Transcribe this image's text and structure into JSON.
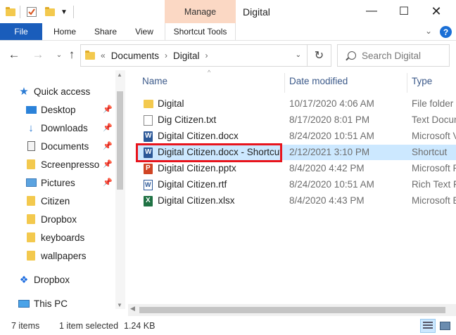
{
  "window": {
    "title": "Digital",
    "manage_label": "Manage",
    "minimize_glyph": "—",
    "maximize_glyph": "☐",
    "close_glyph": "✕"
  },
  "ribbon": {
    "tabs": [
      "File",
      "Home",
      "Share",
      "View",
      "Shortcut Tools"
    ],
    "collapse_glyph": "⌄",
    "help_glyph": "?"
  },
  "nav": {
    "back_glyph": "←",
    "forward_glyph": "→",
    "recent_glyph": "⌄",
    "up_glyph": "↑",
    "overflow_glyph": "«",
    "breadcrumb": [
      "Documents",
      "Digital"
    ],
    "separator": "›",
    "dropdown_glyph": "⌄",
    "refresh_glyph": "↻",
    "search_placeholder": "Search Digital"
  },
  "sidebar": {
    "pin_glyph": "📌",
    "items": [
      {
        "label": "Quick access",
        "icon": "star-icon",
        "pinned": false
      },
      {
        "label": "Desktop",
        "icon": "desktop-icon",
        "pinned": true
      },
      {
        "label": "Downloads",
        "icon": "download-icon",
        "pinned": true
      },
      {
        "label": "Documents",
        "icon": "documents-icon",
        "pinned": true
      },
      {
        "label": "Screenpresso",
        "icon": "folder-icon",
        "pinned": true
      },
      {
        "label": "Pictures",
        "icon": "pictures-icon",
        "pinned": true
      },
      {
        "label": "Citizen",
        "icon": "folder-icon",
        "pinned": false
      },
      {
        "label": "Dropbox",
        "icon": "dropbox-icon",
        "pinned": false
      },
      {
        "label": "keyboards",
        "icon": "folder-icon",
        "pinned": false
      },
      {
        "label": "wallpapers",
        "icon": "folder-icon",
        "pinned": false
      },
      {
        "label": "Dropbox",
        "icon": "dropbox-icon",
        "pinned": false
      },
      {
        "label": "This PC",
        "icon": "computer-icon",
        "pinned": false
      }
    ]
  },
  "filelist": {
    "columns": [
      "Name",
      "Date modified",
      "Type"
    ],
    "sort_glyph": "^",
    "rows": [
      {
        "name": "Digital",
        "date": "10/17/2020 4:06 AM",
        "type": "File folder",
        "icon": "folder-icon"
      },
      {
        "name": "Dig Citizen.txt",
        "date": "8/17/2020 8:01 PM",
        "type": "Text Docun",
        "icon": "text-file-icon"
      },
      {
        "name": "Digital Citizen.docx",
        "date": "8/24/2020 10:51 AM",
        "type": "Microsoft V",
        "icon": "word-file-icon"
      },
      {
        "name": "Digital Citizen.docx - Shortcut",
        "date": "2/12/2021 3:10 PM",
        "type": "Shortcut",
        "icon": "shortcut-icon",
        "selected": true
      },
      {
        "name": "Digital Citizen.pptx",
        "date": "8/4/2020 4:42 PM",
        "type": "Microsoft P",
        "icon": "powerpoint-file-icon"
      },
      {
        "name": "Digital Citizen.rtf",
        "date": "8/24/2020 10:51 AM",
        "type": "Rich Text Fo",
        "icon": "rtf-file-icon"
      },
      {
        "name": "Digital Citizen.xlsx",
        "date": "8/4/2020 4:43 PM",
        "type": "Microsoft E",
        "icon": "excel-file-icon"
      }
    ]
  },
  "status": {
    "item_count": "7 items",
    "selection": "1 item selected",
    "size": "1.24 KB"
  },
  "colors": {
    "file_tab": "#1a5dbb",
    "manage_tab": "#fbd8c4",
    "selection": "#cce8ff",
    "highlight_border": "#e8141c"
  }
}
